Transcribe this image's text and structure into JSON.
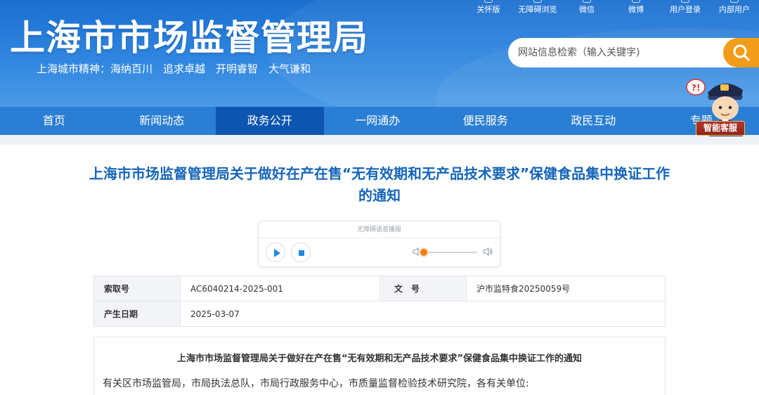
{
  "header": {
    "site_title": "上海市市场监督管理局",
    "slogan": "上海城市精神：海纳百川　追求卓越　开明睿智　大气谦和",
    "top_links": [
      "关怀版",
      "无障碍浏览",
      "微信",
      "微博",
      "用户登录",
      "内部用户"
    ],
    "search_placeholder": "网站信息检索（输入关键字)"
  },
  "nav": {
    "items": [
      "首页",
      "新闻动态",
      "政务公开",
      "一网通办",
      "便民服务",
      "政民互动",
      "专题"
    ],
    "active": "政务公开"
  },
  "service": {
    "label": "智能客服"
  },
  "article": {
    "title": "上海市市场监督管理局关于做好在产在售“无有效期和无产品技术要求”保健食品集中换证工作的通知"
  },
  "player": {
    "title": "无障碍语音播报"
  },
  "meta": {
    "index_label": "索取号",
    "index_value": "AC6040214-2025-001",
    "doc_label": "文　号",
    "doc_value": "沪市监特食20250059号",
    "date_label": "产生日期",
    "date_value": "2025-03-07"
  },
  "body": {
    "title": "上海市市场监督管理局关于做好在产在售“无有效期和无产品技术要求”保健食品集中换证工作的通知",
    "first_paragraph": "有关区市场监管局，市局执法总队，市局行政服务中心，市质量监督检验技术研究院，各有关单位:"
  },
  "colors": {
    "header_blue": "#2f86e0",
    "nav_blue": "#2a7ed3",
    "nav_active": "#0c55b0",
    "title_blue": "#1565ba",
    "search_orange": "#f39c19"
  }
}
